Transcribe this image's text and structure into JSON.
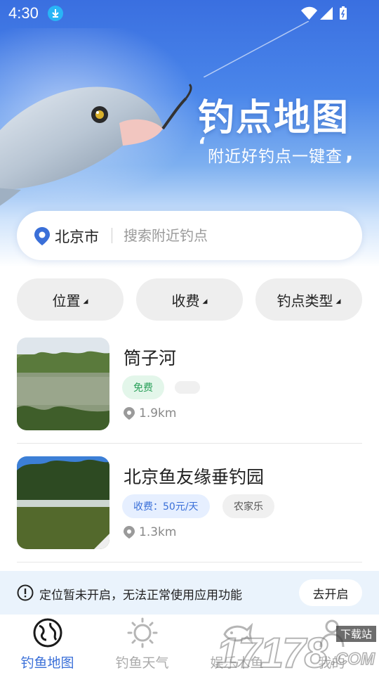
{
  "status_bar": {
    "time": "4:30"
  },
  "hero": {
    "title": "钓点地图",
    "subtitle": "附近好钓点一键查"
  },
  "search": {
    "city": "北京市",
    "placeholder": "搜索附近钓点"
  },
  "filters": [
    {
      "label": "位置"
    },
    {
      "label": "收费"
    },
    {
      "label": "钓点类型"
    }
  ],
  "spots": [
    {
      "name": "筒子河",
      "tags": [
        "免费"
      ],
      "distance": "1.9km"
    },
    {
      "name": "北京鱼友缘垂钓园",
      "tags": [
        "收费：50元/天",
        "农家乐"
      ],
      "distance": "1.3km"
    }
  ],
  "notice": {
    "text": "定位暂未开启，无法正常使用应用功能",
    "button": "去开启"
  },
  "bottom_nav": [
    {
      "label": "钓鱼地图",
      "icon": "globe-icon",
      "active": true
    },
    {
      "label": "钓鱼天气",
      "icon": "sun-icon",
      "active": false
    },
    {
      "label": "娱乐木鱼",
      "icon": "fish-icon",
      "active": false
    },
    {
      "label": "我的",
      "icon": "user-icon",
      "active": false
    }
  ],
  "watermark": {
    "text": "17178",
    "domain": ".COM",
    "tag": "下载站"
  },
  "colors": {
    "accent": "#3a6fd8",
    "hero": "#4a86ea",
    "free_tag": "#2aa05a"
  }
}
